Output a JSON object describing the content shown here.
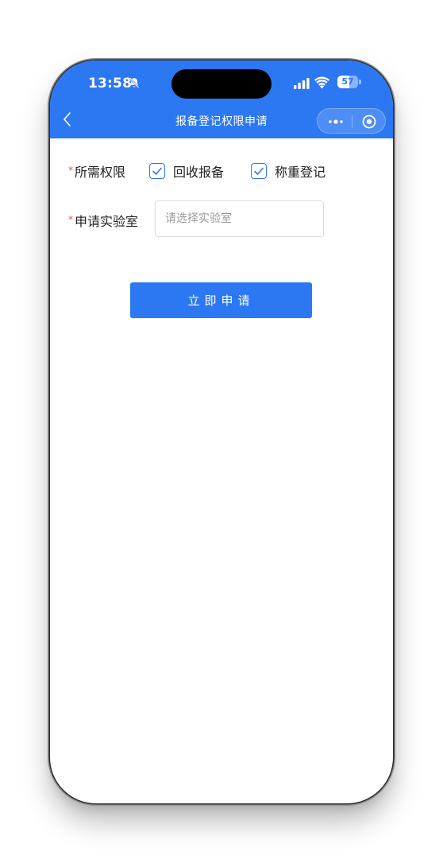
{
  "status_bar": {
    "time": "13:58",
    "battery_level": "57",
    "icons": [
      "bell-slash-icon",
      "signal-icon",
      "wifi-icon",
      "battery-icon"
    ]
  },
  "nav": {
    "title": "报备登记权限申请",
    "icons": [
      "back-chevron-icon",
      "more-dots-icon",
      "target-circle-icon"
    ]
  },
  "form": {
    "required_mark": "*",
    "permissions": {
      "label": "所需权限",
      "options": [
        {
          "label": "回收报备",
          "checked": true
        },
        {
          "label": "称重登记",
          "checked": true
        }
      ]
    },
    "lab": {
      "label": "申请实验室",
      "value": "",
      "placeholder": "请选择实验室"
    },
    "submit_label": "立即申请"
  },
  "colors": {
    "primary": "#2c78f2",
    "required": "#e34d4d",
    "text": "#222222",
    "placeholder": "#9a9a9a"
  }
}
